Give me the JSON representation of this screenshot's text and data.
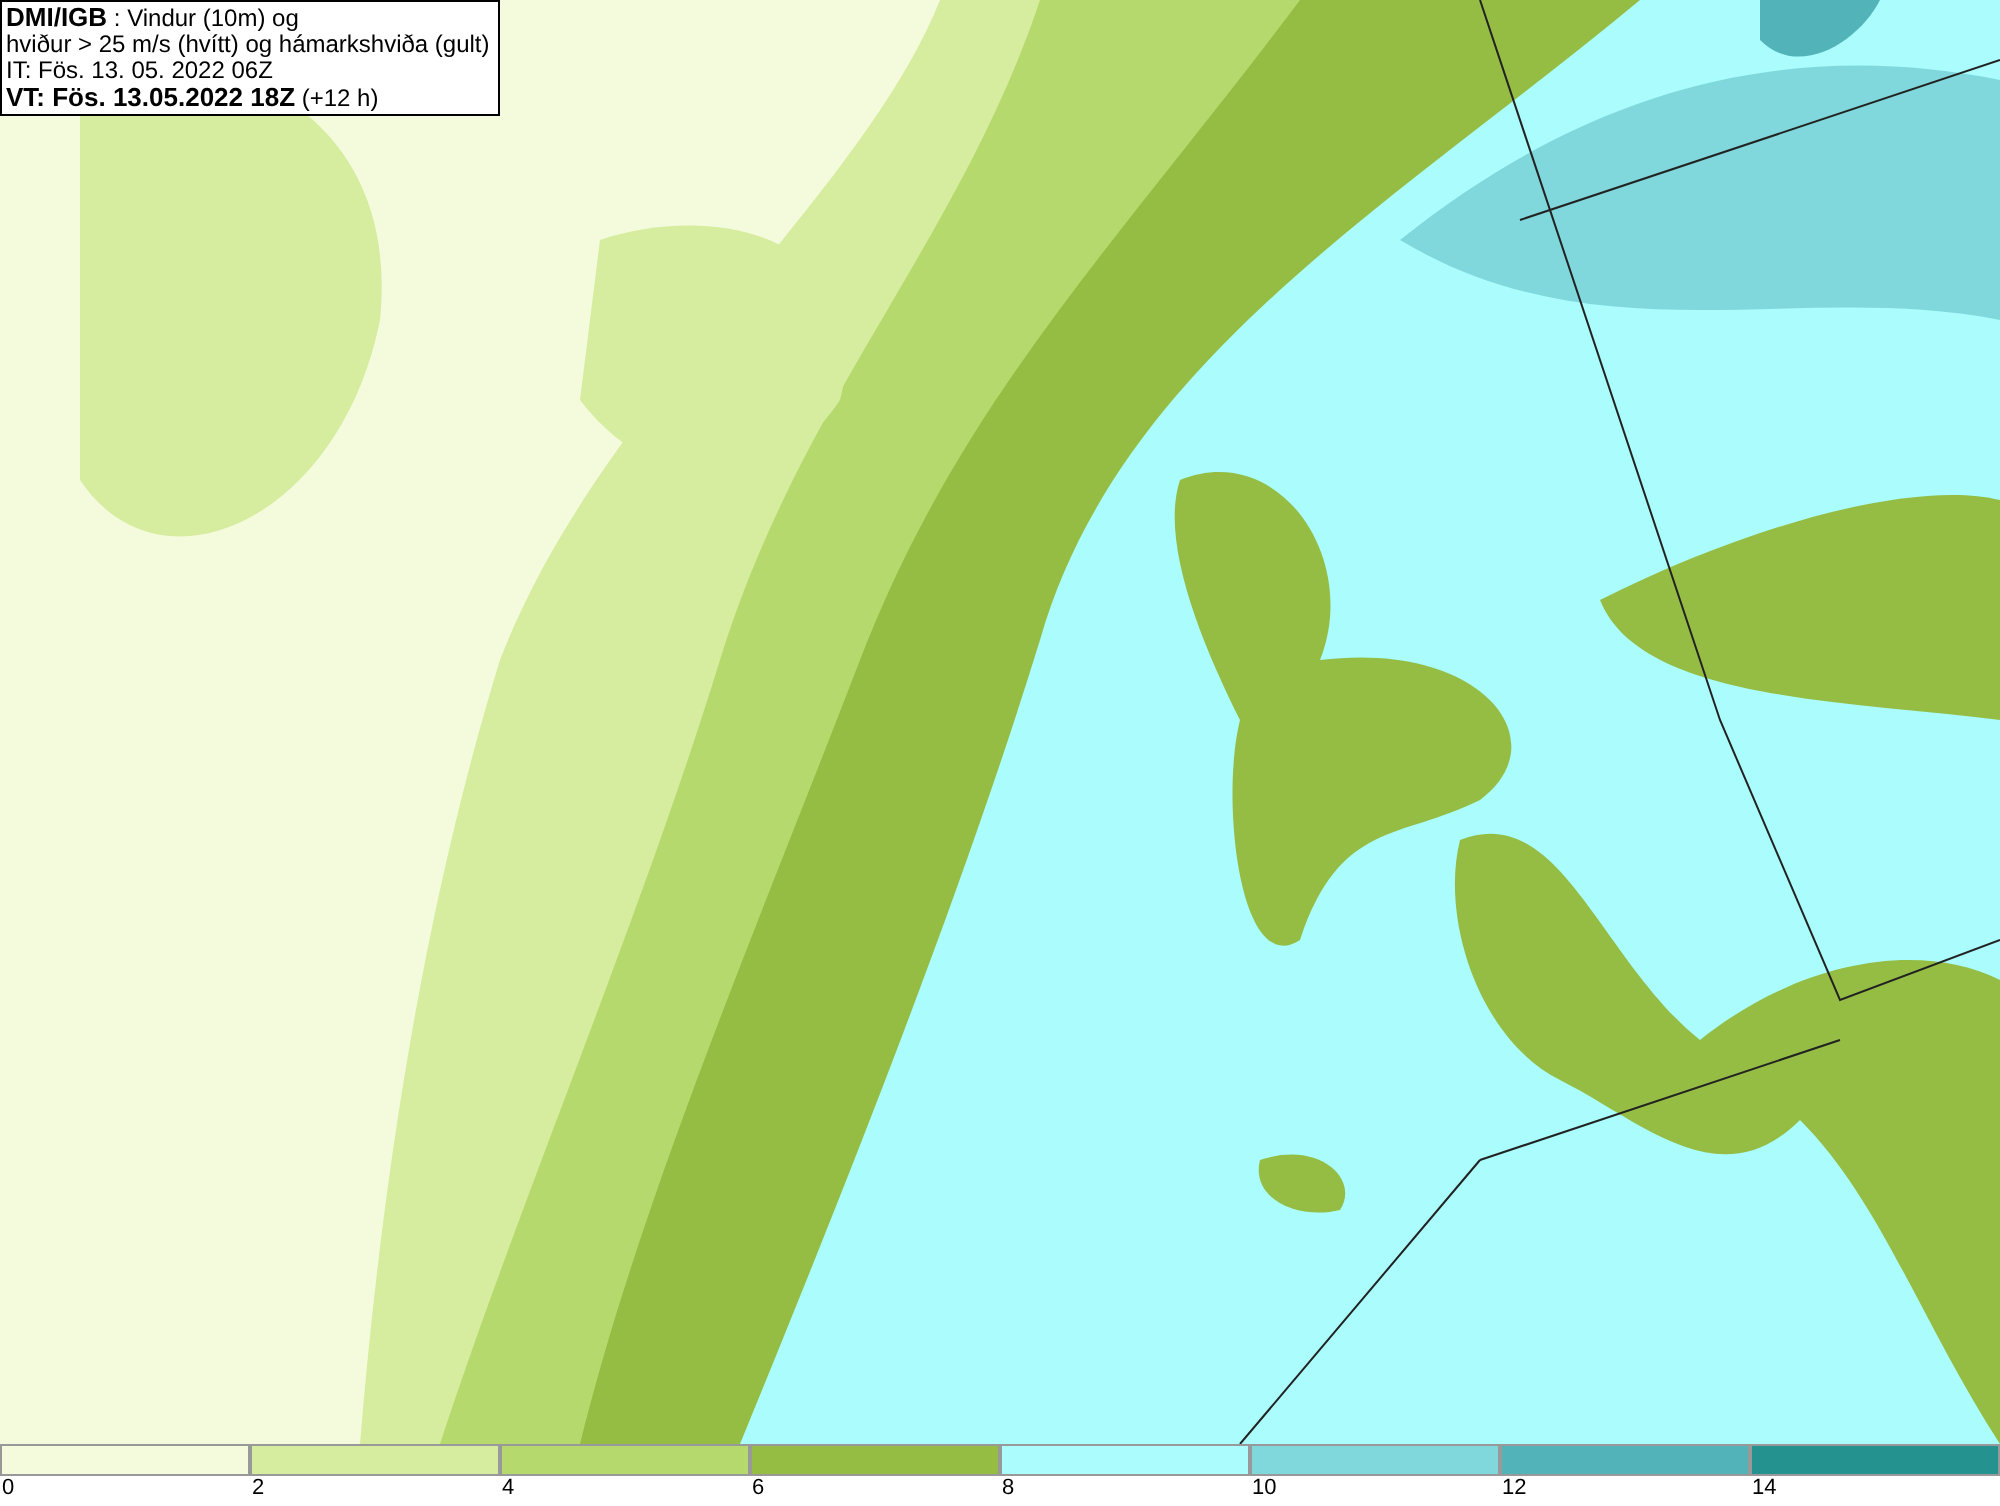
{
  "title_box": {
    "lines": [
      "**DMI/IGB** : Vindur (10m) og",
      "hviður > 25 m/s (hvítt) og hámarkshviða (gult)",
      "IT: Fös. 13. 05. 2022 06Z",
      "**VT: Fös. 13.05.2022 18Z** (+12 h)"
    ]
  },
  "legend": [
    {
      "label": "0",
      "color": "#f4fbdc"
    },
    {
      "label": "2",
      "color": "#d6ec9f"
    },
    {
      "label": "4",
      "color": "#b6d96e"
    },
    {
      "label": "6",
      "color": "#95bd43"
    },
    {
      "label": "8",
      "color": "#aafcfd"
    },
    {
      "label": "10",
      "color": "#80d8dc"
    },
    {
      "label": "12",
      "color": "#52b4b9"
    },
    {
      "label": "14",
      "color": "#24928f"
    }
  ]
}
